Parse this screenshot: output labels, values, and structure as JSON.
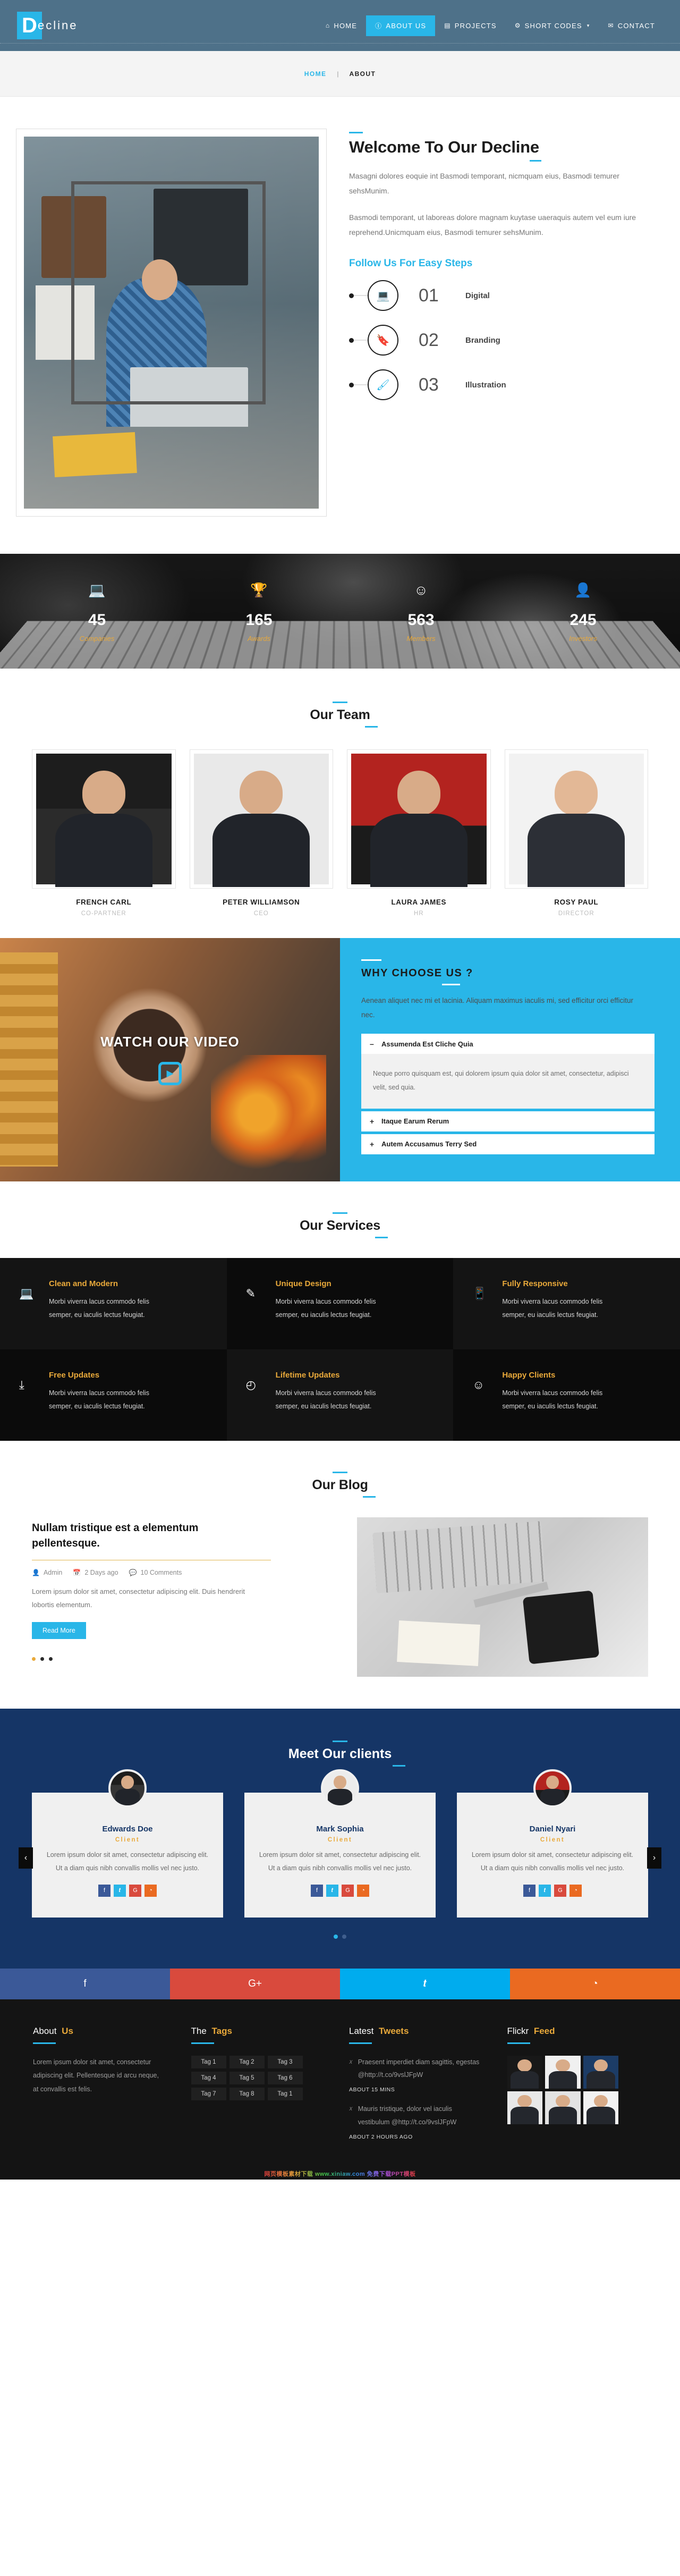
{
  "header": {
    "logo_initial": "D",
    "logo_text": "ecline",
    "nav": [
      {
        "label": "HOME",
        "icon": "home-icon",
        "glyph": "⌂",
        "active": false
      },
      {
        "label": "ABOUT US",
        "icon": "info-icon",
        "glyph": "ⓘ",
        "active": true
      },
      {
        "label": "PROJECTS",
        "icon": "building-icon",
        "glyph": "▤",
        "active": false
      },
      {
        "label": "SHORT CODES",
        "icon": "gear-icon",
        "glyph": "⚙",
        "active": false,
        "caret": "▾"
      },
      {
        "label": "CONTACT",
        "icon": "envelope-icon",
        "glyph": "✉",
        "active": false
      }
    ]
  },
  "breadcrumb": {
    "home": "HOME",
    "separator": "|",
    "current": "ABOUT"
  },
  "welcome": {
    "title": "Welcome To Our Decline",
    "para1": "Masagni dolores eoquie int Basmodi temporant, nicmquam eius, Basmodi temurer sehsMunim.",
    "para2": "Basmodi temporant, ut laboreas dolore magnam kuytase uaeraquis autem vel eum iure reprehend.Unicmquam eius, Basmodi temurer sehsMunim.",
    "follow_title": "Follow Us For Easy Steps",
    "steps": [
      {
        "num": "01",
        "label": "Digital",
        "icon": "laptop-icon",
        "glyph": "💻"
      },
      {
        "num": "02",
        "label": "Branding",
        "icon": "bookmark-icon",
        "glyph": "🔖"
      },
      {
        "num": "03",
        "label": "Illustration",
        "icon": "paintbrush-icon",
        "glyph": "🖌"
      }
    ]
  },
  "counters": [
    {
      "value": "45",
      "label": "Companies",
      "icon": "laptop-icon",
      "glyph": "💻"
    },
    {
      "value": "165",
      "label": "Awards",
      "icon": "trophy-icon",
      "glyph": "🏆"
    },
    {
      "value": "563",
      "label": "Members",
      "icon": "smiley-icon",
      "glyph": "☺"
    },
    {
      "value": "245",
      "label": "Investors",
      "icon": "user-icon",
      "glyph": "👤"
    }
  ],
  "team": {
    "title": "Our Team",
    "members": [
      {
        "name": "FRENCH CARL",
        "role": "CO-PARTNER"
      },
      {
        "name": "PETER WILLIAMSON",
        "role": "CEO"
      },
      {
        "name": "LAURA JAMES",
        "role": "HR"
      },
      {
        "name": "ROSY PAUL",
        "role": "DIRECTOR"
      }
    ]
  },
  "video": {
    "title": "WATCH OUR VIDEO",
    "play_icon": "play-icon",
    "play_glyph": "▶"
  },
  "why_choose": {
    "title": "WHY CHOOSE US ?",
    "para": "Aenean aliquet nec mi et lacinia. Aliquam maximus iaculis mi, sed efficitur orci efficitur nec.",
    "accordion": [
      {
        "sign": "–",
        "title": "Assumenda Est Cliche Quia",
        "open": true,
        "body": "Neque porro quisquam est, qui dolorem ipsum quia dolor sit amet, consectetur, adipisci velit, sed quia."
      },
      {
        "sign": "+",
        "title": "Itaque Earum Rerum",
        "open": false,
        "body": ""
      },
      {
        "sign": "+",
        "title": "Autem Accusamus Terry Sed",
        "open": false,
        "body": ""
      }
    ]
  },
  "services": {
    "title": "Our Services",
    "items": [
      {
        "title": "Clean and Modern",
        "desc": "Morbi viverra lacus commodo felis semper, eu iaculis lectus feugiat.",
        "icon": "laptop-icon",
        "glyph": "💻"
      },
      {
        "title": "Unique Design",
        "desc": "Morbi viverra lacus commodo felis semper, eu iaculis lectus feugiat.",
        "icon": "pencil-icon",
        "glyph": "✎"
      },
      {
        "title": "Fully Responsive",
        "desc": "Morbi viverra lacus commodo felis semper, eu iaculis lectus feugiat.",
        "icon": "mobile-icon",
        "glyph": "📱"
      },
      {
        "title": "Free Updates",
        "desc": "Morbi viverra lacus commodo felis semper, eu iaculis lectus feugiat.",
        "icon": "download-icon",
        "glyph": "⤓"
      },
      {
        "title": "Lifetime Updates",
        "desc": "Morbi viverra lacus commodo felis semper, eu iaculis lectus feugiat.",
        "icon": "clock-icon",
        "glyph": "◴"
      },
      {
        "title": "Happy Clients",
        "desc": "Morbi viverra lacus commodo felis semper, eu iaculis lectus feugiat.",
        "icon": "smiley-icon",
        "glyph": "☺"
      }
    ]
  },
  "blog": {
    "title": "Our Blog",
    "post": {
      "heading": "Nullam tristique est a elementum pellentesque.",
      "author": "Admin",
      "author_icon": "user-icon",
      "date": "2 Days ago",
      "date_icon": "calendar-icon",
      "comments": "10 Comments",
      "comments_icon": "comment-icon",
      "excerpt": "Lorem ipsum dolor sit amet, consectetur adipiscing elit. Duis hendrerit lobortis elementum.",
      "read_more": "Read More"
    }
  },
  "clients": {
    "title": "Meet Our clients",
    "prev_icon": "chevron-left-icon",
    "next_icon": "chevron-right-icon",
    "prev_glyph": "‹",
    "next_glyph": "›",
    "items": [
      {
        "name": "Edwards Doe",
        "role": "Client",
        "text": "Lorem ipsum dolor sit amet, consectetur adipiscing elit. Ut a diam quis nibh convallis mollis vel nec justo."
      },
      {
        "name": "Mark Sophia",
        "role": "Client",
        "text": "Lorem ipsum dolor sit amet, consectetur adipiscing elit. Ut a diam quis nibh convallis mollis vel nec justo."
      },
      {
        "name": "Daniel Nyari",
        "role": "Client",
        "text": "Lorem ipsum dolor sit amet, consectetur adipiscing elit. Ut a diam quis nibh convallis mollis vel nec justo."
      }
    ],
    "card_socials": [
      {
        "name": "facebook-icon",
        "glyph": "f"
      },
      {
        "name": "twitter-icon",
        "glyph": "𝒕"
      },
      {
        "name": "google-plus-icon",
        "glyph": "G"
      },
      {
        "name": "rss-icon",
        "glyph": "◔"
      }
    ]
  },
  "social_bar": [
    {
      "name": "facebook-icon",
      "glyph": "f",
      "color": "#3b5998"
    },
    {
      "name": "google-plus-icon",
      "glyph": "G+",
      "color": "#d94a3d"
    },
    {
      "name": "twitter-icon",
      "glyph": "𝒕",
      "color": "#00acee"
    },
    {
      "name": "rss-icon",
      "glyph": "◔",
      "color": "#ea6a21"
    }
  ],
  "footer": {
    "about": {
      "title_1": "About",
      "title_2": "Us",
      "text": "Lorem ipsum dolor sit amet, consectetur adipiscing elit. Pellentesque id arcu neque, at convallis est felis."
    },
    "tags": {
      "title_1": "The",
      "title_2": "Tags",
      "items": [
        "Tag 1",
        "Tag 2",
        "Tag 3",
        "Tag 4",
        "Tag 5",
        "Tag 6",
        "Tag 7",
        "Tag 8",
        "Tag 1"
      ]
    },
    "tweets": {
      "title_1": "Latest",
      "title_2": "Tweets",
      "items": [
        {
          "text": "Praesent imperdiet diam sagittis, egestas @http://t.co/9vslJFpW",
          "time": "ABOUT 15 MINS"
        },
        {
          "text": "Mauris tristique, dolor vel iaculis vestibulum @http://t.co/9vslJFpW",
          "time": "ABOUT 2 HOURS AGO"
        }
      ]
    },
    "flickr": {
      "title_1": "Flickr",
      "title_2": "Feed",
      "count": 6
    }
  },
  "watermark": "网页模板素材下载 www.xiniaw.com 免费下载PPT模板"
}
